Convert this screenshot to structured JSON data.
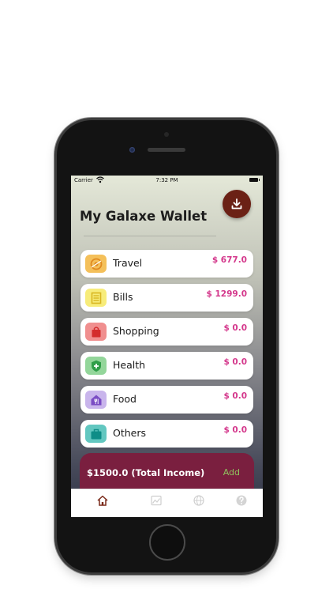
{
  "status_bar": {
    "carrier": "Carrier",
    "time": "7:32 PM"
  },
  "header": {
    "title": "My Galaxe Wallet"
  },
  "categories": [
    {
      "label": "Travel",
      "amount": "$ 677.0",
      "icon": "travel-icon",
      "icon_bg": "#f4c05a",
      "icon_fg": "#e08a20"
    },
    {
      "label": "Bills",
      "amount": "$ 1299.0",
      "icon": "bills-icon",
      "icon_bg": "#f7ec7a",
      "icon_fg": "#d8b520"
    },
    {
      "label": "Shopping",
      "amount": "$ 0.0",
      "icon": "shopping-bag-icon",
      "icon_bg": "#f08f8f",
      "icon_fg": "#d42c2c"
    },
    {
      "label": "Health",
      "amount": "$ 0.0",
      "icon": "health-shield-icon",
      "icon_bg": "#93d69a",
      "icon_fg": "#2f9e48"
    },
    {
      "label": "Food",
      "amount": "$ 0.0",
      "icon": "food-icon",
      "icon_bg": "#c9b5ec",
      "icon_fg": "#7a4cc4"
    },
    {
      "label": "Others",
      "amount": "$ 0.0",
      "icon": "briefcase-icon",
      "icon_bg": "#62c7c0",
      "icon_fg": "#0e8d87"
    }
  ],
  "income": {
    "text": "$1500.0 (Total Income)",
    "add_label": "Add"
  },
  "tabs": [
    "home-icon",
    "chart-icon",
    "globe-icon",
    "help-icon"
  ],
  "colors": {
    "accent": "#6b2115",
    "amount": "#d4388c",
    "income_card": "#7a1f3f",
    "add": "#8fc45f",
    "tab_active": "#7a2a1a",
    "tab_inactive": "#cfcfcf"
  }
}
